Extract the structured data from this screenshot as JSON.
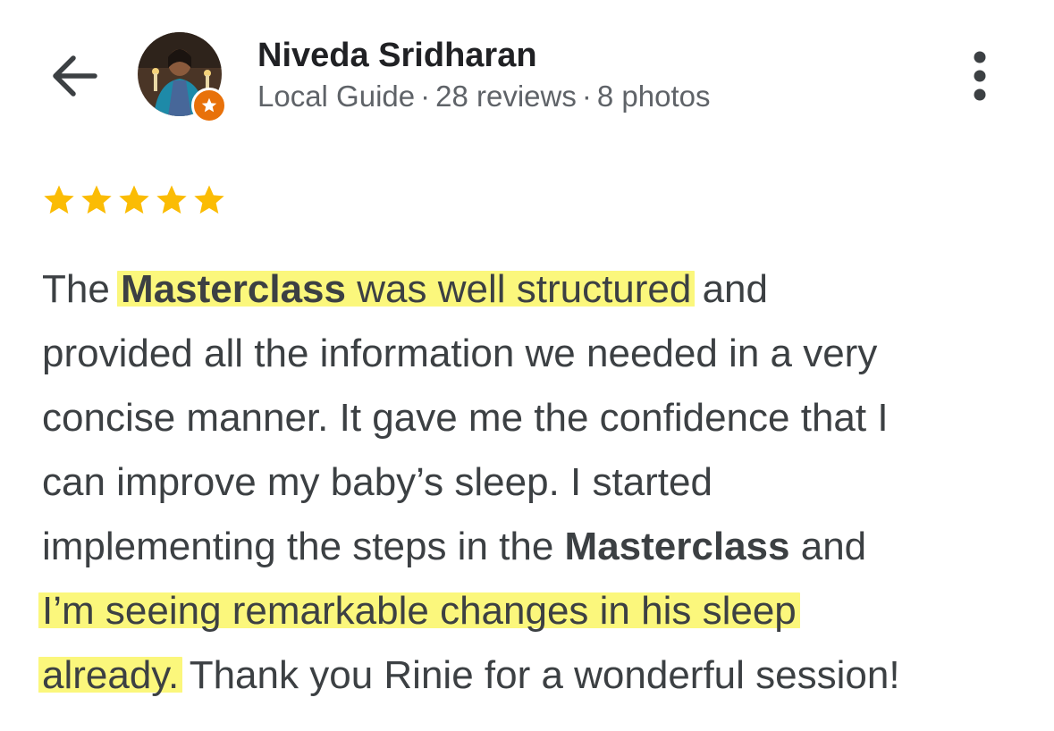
{
  "header": {
    "back_icon": "arrow-left-icon",
    "reviewer_name": "Niveda Sridharan",
    "meta": {
      "badge": "Local Guide",
      "separator": "·",
      "reviews": "28 reviews",
      "photos": "8 photos"
    },
    "local_guide_badge_icon": "star-badge-icon",
    "more_icon": "more-vertical-icon"
  },
  "review": {
    "rating": 5,
    "rating_max": 5,
    "star_color": "#fbbc04",
    "highlight_color": "#fbf77c",
    "lines": {
      "l1": {
        "a": "The ",
        "b": "Masterclass",
        "c": " was well structured",
        "d": " and"
      },
      "l2": "provided all the information we needed in a very",
      "l3": "concise manner. It gave me the confidence that I",
      "l4": "can improve my baby’s sleep. I started",
      "l5": {
        "a": "implementing the steps in the ",
        "b": "Masterclass",
        "c": " and"
      },
      "l6": "I’m seeing remarkable changes in his sleep",
      "l7": {
        "a": "already.",
        "b": " Thank you Rinie for a wonderful session!"
      }
    }
  }
}
